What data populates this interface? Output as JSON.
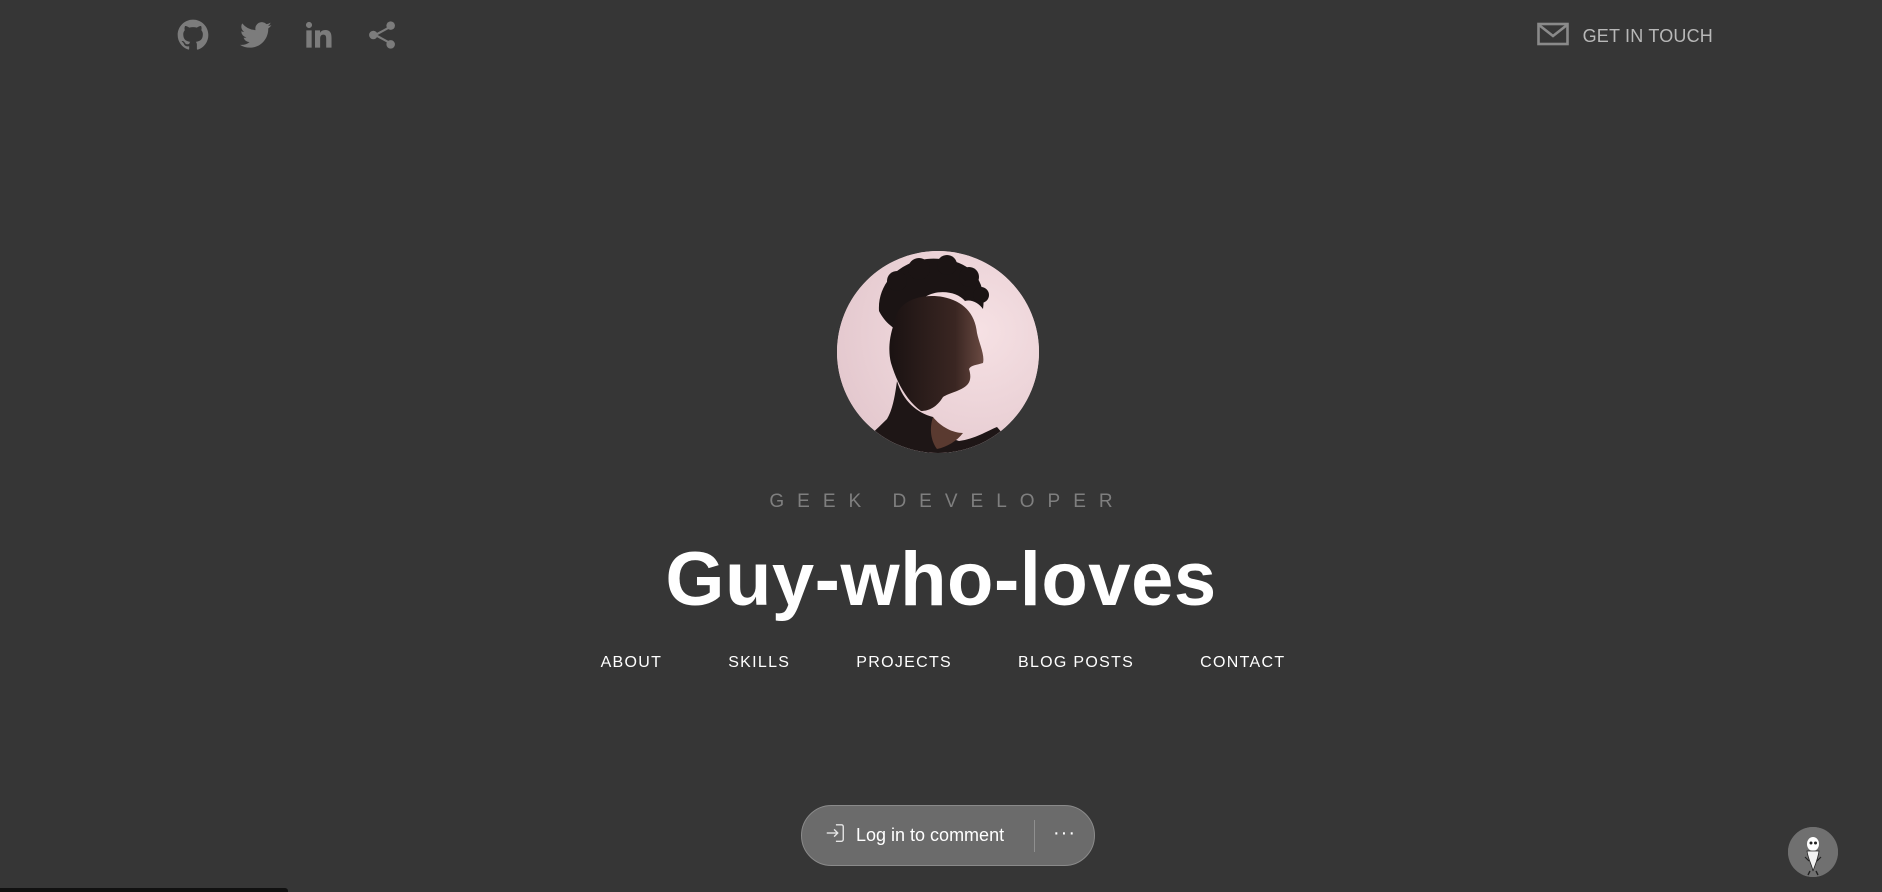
{
  "social": {
    "icons": [
      {
        "name": "github-icon"
      },
      {
        "name": "twitter-icon"
      },
      {
        "name": "linkedin-icon"
      },
      {
        "name": "share-icon"
      }
    ]
  },
  "header": {
    "cta_label": "GET IN TOUCH",
    "cta_icon": "mail-icon"
  },
  "hero": {
    "tagline": "GEEK DEVELOPER",
    "headline": "Guy-who-loves"
  },
  "nav": {
    "items": [
      {
        "label": "ABOUT"
      },
      {
        "label": "SKILLS"
      },
      {
        "label": "PROJECTS"
      },
      {
        "label": "BLOG POSTS"
      },
      {
        "label": "CONTACT"
      }
    ]
  },
  "comments": {
    "login_label": "Log in to comment",
    "login_icon": "sign-in-icon",
    "more_label": "···"
  },
  "colors": {
    "background": "#363636",
    "icon_gray": "#7c7c7c",
    "tagline_gray": "#7f7f7f",
    "pill_bg": "#6b6b6b"
  }
}
